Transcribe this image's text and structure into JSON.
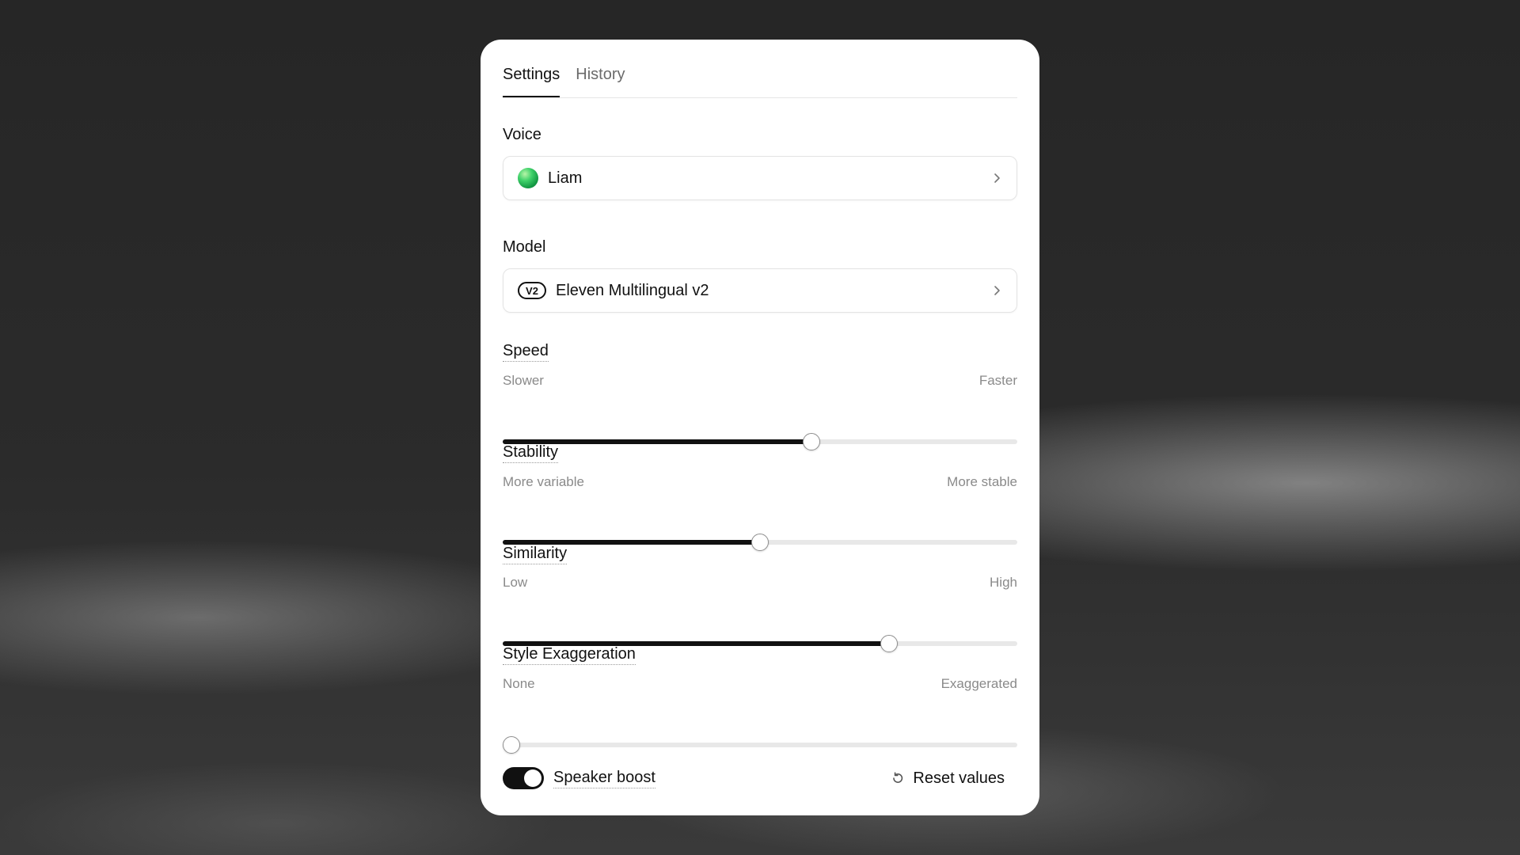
{
  "tabs": [
    {
      "label": "Settings",
      "active": true
    },
    {
      "label": "History",
      "active": false
    }
  ],
  "voice": {
    "label": "Voice",
    "value": "Liam",
    "avatar_icon": "green-orb-avatar"
  },
  "model": {
    "label": "Model",
    "badge": "V2",
    "value": "Eleven Multilingual v2"
  },
  "sliders": {
    "speed": {
      "label": "Speed",
      "min_label": "Slower",
      "max_label": "Faster",
      "fraction": 0.6
    },
    "stability": {
      "label": "Stability",
      "min_label": "More variable",
      "max_label": "More stable",
      "fraction": 0.5
    },
    "similarity": {
      "label": "Similarity",
      "min_label": "Low",
      "max_label": "High",
      "fraction": 0.75
    },
    "style": {
      "label": "Style Exaggeration",
      "min_label": "None",
      "max_label": "Exaggerated",
      "fraction": 0.0
    }
  },
  "footer": {
    "speaker_boost_label": "Speaker boost",
    "speaker_boost_on": true,
    "reset_label": "Reset values"
  },
  "colors": {
    "accent": "#111111",
    "track": "#e8e8e8",
    "panel": "#ffffff"
  }
}
